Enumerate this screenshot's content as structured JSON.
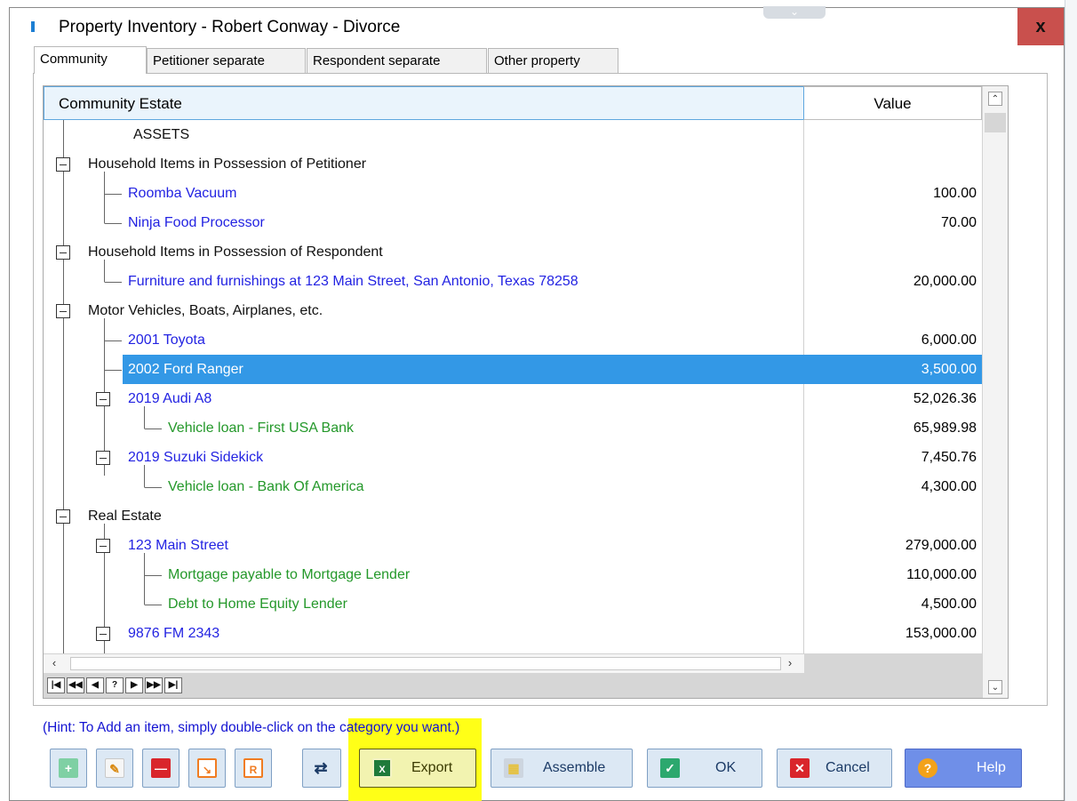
{
  "window": {
    "title": "Property Inventory - Robert Conway - Divorce",
    "close_label": "x"
  },
  "tabs": [
    {
      "label": "Community",
      "active": true
    },
    {
      "label": "Petitioner separate",
      "active": false
    },
    {
      "label": "Respondent separate",
      "active": false
    },
    {
      "label": "Other property",
      "active": false
    }
  ],
  "grid": {
    "columns": [
      "Community Estate",
      "Value"
    ],
    "rows": [
      {
        "label": "ASSETS",
        "value": "",
        "color": "#111111"
      },
      {
        "label": "Household Items in Possession of Petitioner",
        "value": "",
        "color": "#111111"
      },
      {
        "label": "Roomba Vacuum",
        "value": "100.00",
        "color": "#2323e2"
      },
      {
        "label": "Ninja Food Processor",
        "value": "70.00",
        "color": "#2323e2"
      },
      {
        "label": "Household Items in Possession of Respondent",
        "value": "",
        "color": "#111111"
      },
      {
        "label": "Furniture and furnishings at 123 Main Street, San Antonio, Texas 78258",
        "value": "20,000.00",
        "color": "#2323e2"
      },
      {
        "label": "Motor Vehicles, Boats, Airplanes, etc.",
        "value": "",
        "color": "#111111"
      },
      {
        "label": "2001 Toyota",
        "value": "6,000.00",
        "color": "#2323e2"
      },
      {
        "label": "2002 Ford Ranger",
        "value": "3,500.00",
        "color": "#2323e2",
        "selected": true
      },
      {
        "label": "2019 Audi A8",
        "value": "52,026.36",
        "color": "#2323e2"
      },
      {
        "label": "Vehicle loan - First USA Bank",
        "value": "65,989.98",
        "color": "#24982a"
      },
      {
        "label": "2019 Suzuki Sidekick",
        "value": "7,450.76",
        "color": "#2323e2"
      },
      {
        "label": "Vehicle loan - Bank Of America",
        "value": "4,300.00",
        "color": "#24982a"
      },
      {
        "label": "Real Estate",
        "value": "",
        "color": "#111111"
      },
      {
        "label": "123 Main Street",
        "value": "279,000.00",
        "color": "#2323e2"
      },
      {
        "label": "Mortgage payable to Mortgage Lender",
        "value": "110,000.00",
        "color": "#24982a"
      },
      {
        "label": "Debt to Home Equity Lender",
        "value": "4,500.00",
        "color": "#24982a"
      },
      {
        "label": "9876 FM 2343",
        "value": "153,000.00",
        "color": "#2323e2"
      }
    ],
    "navigator": [
      "|◀",
      "◀◀",
      "◀",
      "?",
      "▶",
      "▶▶",
      "▶|"
    ]
  },
  "hint": "(Hint: To Add an item, simply double-click on the category you want.)",
  "buttons": {
    "add_icon": "plus-icon",
    "edit_icon": "edit-icon",
    "delete_icon": "minus-icon",
    "move_icon": "move-icon",
    "move2_icon": "move-right-icon",
    "swap_icon": "swap-icon",
    "export": "Export",
    "assemble": "Assemble",
    "ok": "OK",
    "cancel": "Cancel",
    "help": "Help"
  },
  "colors": {
    "selection": "#3398e6",
    "item_blue": "#2323e2",
    "item_green": "#24982a",
    "highlight": "#ffff17"
  }
}
